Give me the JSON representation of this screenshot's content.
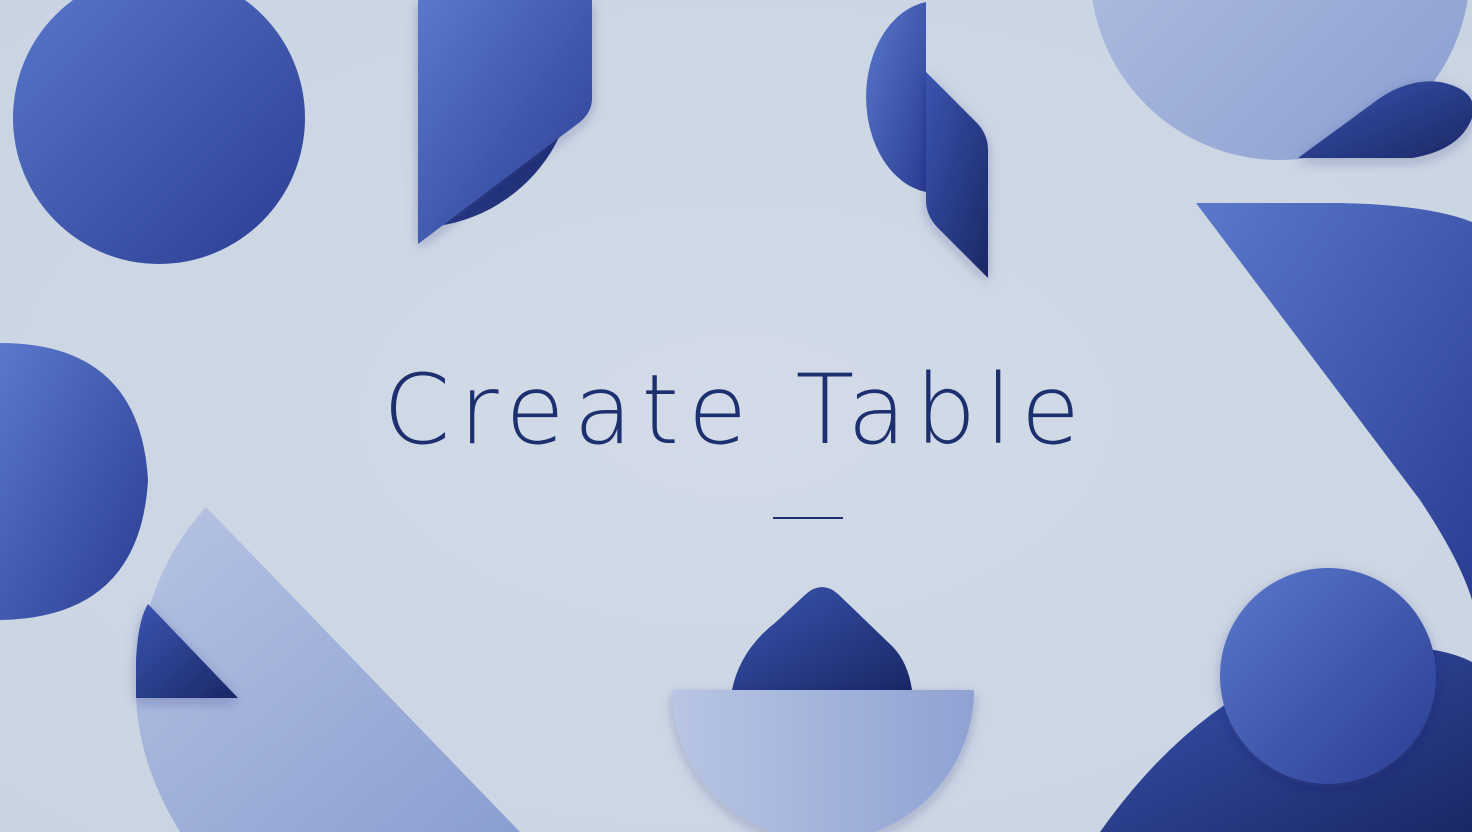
{
  "title": "Create Table",
  "colors": {
    "background": "#cdd7e5",
    "title_text": "#1c2f6e",
    "shape_dark_blue": "#2a3f96",
    "shape_mid_blue": "#4a64bd",
    "shape_light_blue": "#9fb0da"
  }
}
